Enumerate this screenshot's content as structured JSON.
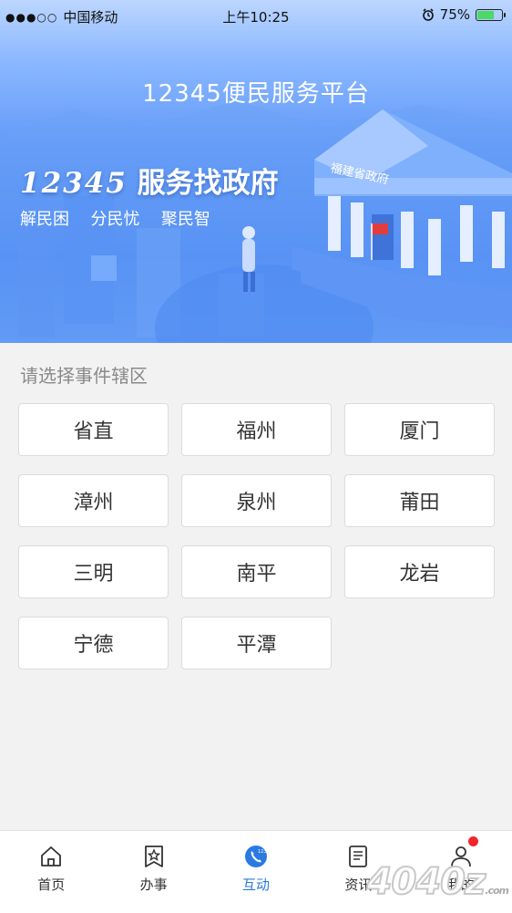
{
  "status_bar": {
    "carrier": "中国移动",
    "time": "上午10:25",
    "battery": "75%",
    "battery_level": 0.75
  },
  "banner": {
    "title": "12345便民服务平台",
    "slogan_numbers": "12345",
    "slogan_text": "服务找政府",
    "tagline": "解民困  分民忧  聚民智",
    "building_sign": "福建省政府"
  },
  "region": {
    "prompt": "请选择事件辖区",
    "options": [
      "省直",
      "福州",
      "厦门",
      "漳州",
      "泉州",
      "莆田",
      "三明",
      "南平",
      "龙岩",
      "宁德",
      "平潭"
    ]
  },
  "tabbar": {
    "tabs": [
      {
        "label": "首页",
        "icon": "home-icon"
      },
      {
        "label": "办事",
        "icon": "star-bookmark-icon"
      },
      {
        "label": "互动",
        "icon": "phone-12345-icon",
        "active": true
      },
      {
        "label": "资讯",
        "icon": "document-icon"
      },
      {
        "label": "我的",
        "icon": "user-icon",
        "badge": true
      }
    ],
    "active_color": "#2a7ae2",
    "phone_badge_text": "12345"
  },
  "watermark": {
    "text": "4040z",
    "suffix": ".com"
  }
}
